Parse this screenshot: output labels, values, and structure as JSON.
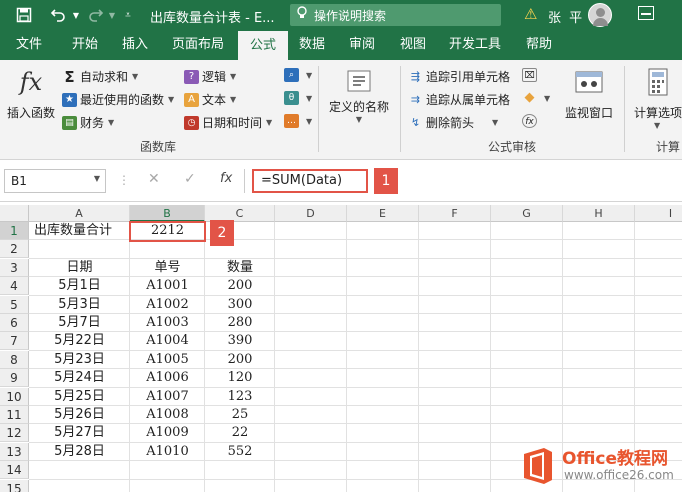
{
  "titlebar": {
    "title": "出库数量合计表 - E...",
    "tell_me": "操作说明搜索",
    "user": "张 平"
  },
  "tabs": [
    {
      "label": "文件"
    },
    {
      "label": "开始"
    },
    {
      "label": "插入"
    },
    {
      "label": "页面布局"
    },
    {
      "label": "公式",
      "active": true
    },
    {
      "label": "数据"
    },
    {
      "label": "审阅"
    },
    {
      "label": "视图"
    },
    {
      "label": "开发工具"
    },
    {
      "label": "帮助"
    }
  ],
  "ribbon": {
    "insert_function": "插入函数",
    "autosum": "自动求和",
    "recently_used": "最近使用的函数",
    "financial": "财务",
    "logical": "逻辑",
    "text": "文本",
    "date_time": "日期和时间",
    "library_label": "函数库",
    "defined_names": "定义的名称",
    "trace_precedents": "追踪引用单元格",
    "trace_dependents": "追踪从属单元格",
    "remove_arrows": "删除箭头",
    "audit_label": "公式审核",
    "watch_window": "监视窗口",
    "calc_options": "计算选项",
    "calc_label": "计算"
  },
  "formula_bar": {
    "name_box": "B1",
    "formula": "=SUM(Data)",
    "fx": "fx"
  },
  "callouts": {
    "one": "1",
    "two": "2"
  },
  "columns": [
    "A",
    "B",
    "C",
    "D",
    "E",
    "F",
    "G",
    "H",
    "I"
  ],
  "rows": [
    "1",
    "2",
    "3",
    "4",
    "5",
    "6",
    "7",
    "8",
    "9",
    "10",
    "11",
    "12",
    "13",
    "14",
    "15"
  ],
  "sheet": {
    "a1": "出库数量合计",
    "b1": "2212",
    "headers": {
      "date": "日期",
      "order": "单号",
      "qty": "数量"
    },
    "records": [
      {
        "date": "5月1日",
        "order": "A1001",
        "qty": "200"
      },
      {
        "date": "5月3日",
        "order": "A1002",
        "qty": "300"
      },
      {
        "date": "5月7日",
        "order": "A1003",
        "qty": "280"
      },
      {
        "date": "5月22日",
        "order": "A1004",
        "qty": "390"
      },
      {
        "date": "5月23日",
        "order": "A1005",
        "qty": "200"
      },
      {
        "date": "5月24日",
        "order": "A1006",
        "qty": "120"
      },
      {
        "date": "5月25日",
        "order": "A1007",
        "qty": "123"
      },
      {
        "date": "5月26日",
        "order": "A1008",
        "qty": "25"
      },
      {
        "date": "5月27日",
        "order": "A1009",
        "qty": "22"
      },
      {
        "date": "5月28日",
        "order": "A1010",
        "qty": "552"
      }
    ]
  },
  "logo": {
    "brand": "Office教程网",
    "url": "www.office26.com"
  },
  "colors": {
    "excel_green": "#217346",
    "highlight": "#e25447",
    "logo_orange": "#e8552e"
  }
}
